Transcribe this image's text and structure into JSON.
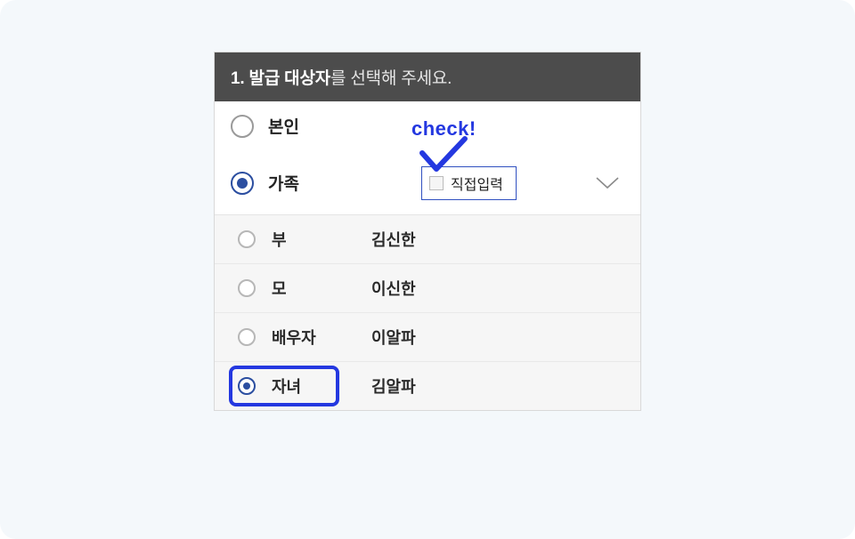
{
  "header": {
    "number": "1.",
    "bold": "발급 대상자",
    "light": "를 선택해 주세요."
  },
  "topOptions": {
    "self": {
      "label": "본인",
      "selected": false
    },
    "family": {
      "label": "가족",
      "selected": true,
      "directInputLabel": "직접입력"
    }
  },
  "familyMembers": [
    {
      "rel": "부",
      "name": "김신한",
      "selected": false
    },
    {
      "rel": "모",
      "name": "이신한",
      "selected": false
    },
    {
      "rel": "배우자",
      "name": "이알파",
      "selected": false
    },
    {
      "rel": "자녀",
      "name": "김알파",
      "selected": true,
      "highlighted": true
    }
  ],
  "annotation": {
    "text": "check!"
  },
  "colors": {
    "accent": "#2438e0",
    "radioBlue": "#2b4ea0"
  }
}
